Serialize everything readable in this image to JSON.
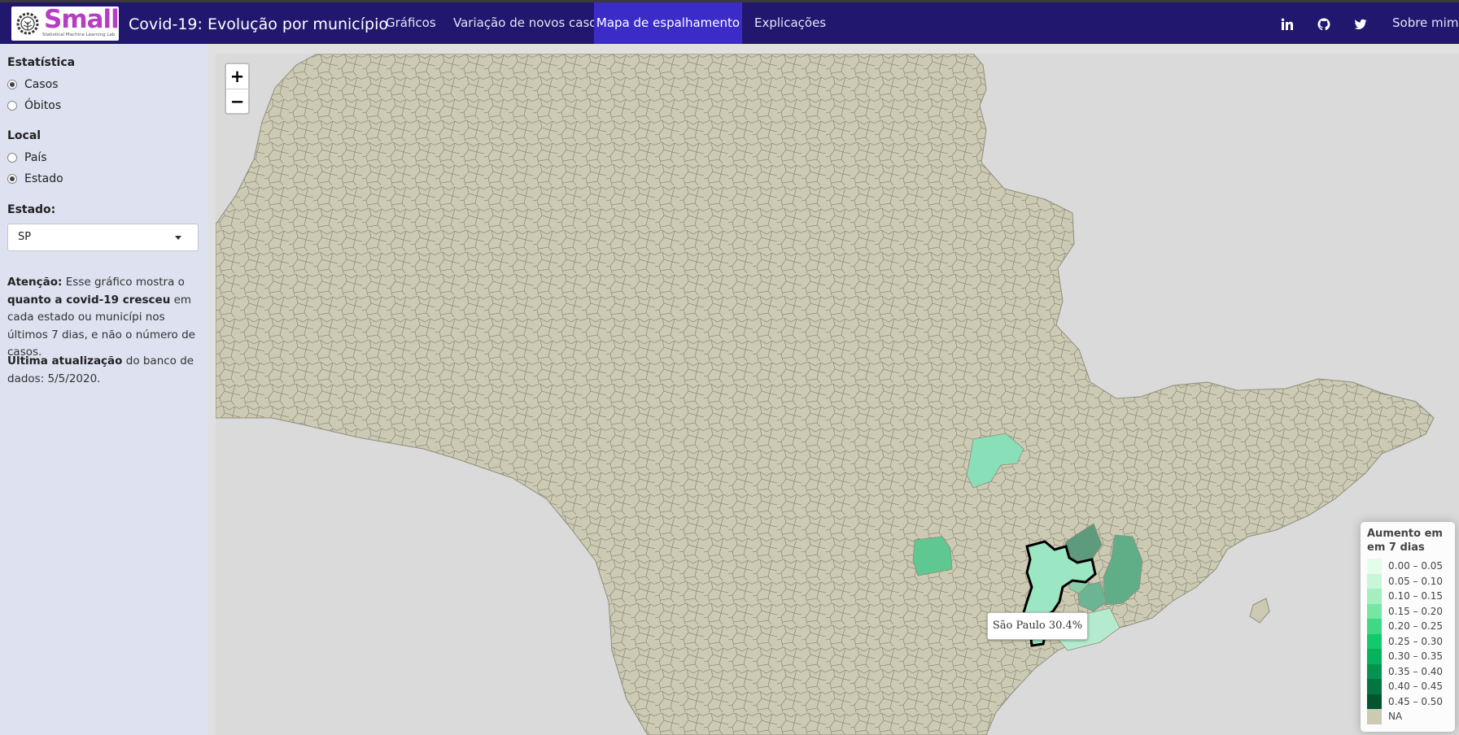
{
  "navbar": {
    "logo_word": "Small",
    "logo_tagline": "Statistical Machine Learning Lab",
    "title": "Covid-19: Evolução por município",
    "items": [
      {
        "label": "Gráficos",
        "active": false
      },
      {
        "label": "Variação de novos casos",
        "active": false
      },
      {
        "label": "Mapa de espalhamento",
        "active": true
      },
      {
        "label": "Explicações",
        "active": false
      }
    ],
    "right_icons": [
      "linkedin-icon",
      "github-icon",
      "twitter-icon"
    ],
    "about_label": "Sobre mim"
  },
  "sidebar": {
    "estatistica": {
      "label": "Estatística",
      "options": [
        {
          "label": "Casos",
          "selected": true
        },
        {
          "label": "Óbitos",
          "selected": false
        }
      ]
    },
    "local": {
      "label": "Local",
      "options": [
        {
          "label": "País",
          "selected": false
        },
        {
          "label": "Estado",
          "selected": true
        }
      ]
    },
    "estado": {
      "label": "Estado:",
      "value": "SP"
    },
    "note": {
      "attention_strong": "Atenção:",
      "attention_text1": " Esse gráfico mostra o ",
      "attention_strong2": "quanto a covid-19 cresceu",
      "attention_text2": " em cada estado ou municípi nos últimos 7 dias, e não o número de casos.",
      "update_strong": "Última atualização",
      "update_text": " do banco de dados: 5/5/2020."
    }
  },
  "map": {
    "zoom_in": "+",
    "zoom_out": "−",
    "tooltip": "São Paulo 30.4%",
    "colors": {
      "land": "#cccab2",
      "border": "#8f8d7d",
      "background": "#dadada"
    },
    "legend": {
      "title": "Aumento em em 7 dias",
      "items": [
        {
          "label": "0.00 – 0.05",
          "color": "#e5fbec"
        },
        {
          "label": "0.05 – 0.10",
          "color": "#c7f6d8"
        },
        {
          "label": "0.10 – 0.15",
          "color": "#a4efc0"
        },
        {
          "label": "0.15 – 0.20",
          "color": "#76e6a3"
        },
        {
          "label": "0.20 – 0.25",
          "color": "#3ed986"
        },
        {
          "label": "0.25 – 0.30",
          "color": "#12c96c"
        },
        {
          "label": "0.30 – 0.35",
          "color": "#06b25e"
        },
        {
          "label": "0.35 – 0.40",
          "color": "#049450"
        },
        {
          "label": "0.40 – 0.45",
          "color": "#037541"
        },
        {
          "label": "0.45 – 0.50",
          "color": "#02552f"
        },
        {
          "label": "NA",
          "color": "#cccab2"
        }
      ]
    }
  }
}
